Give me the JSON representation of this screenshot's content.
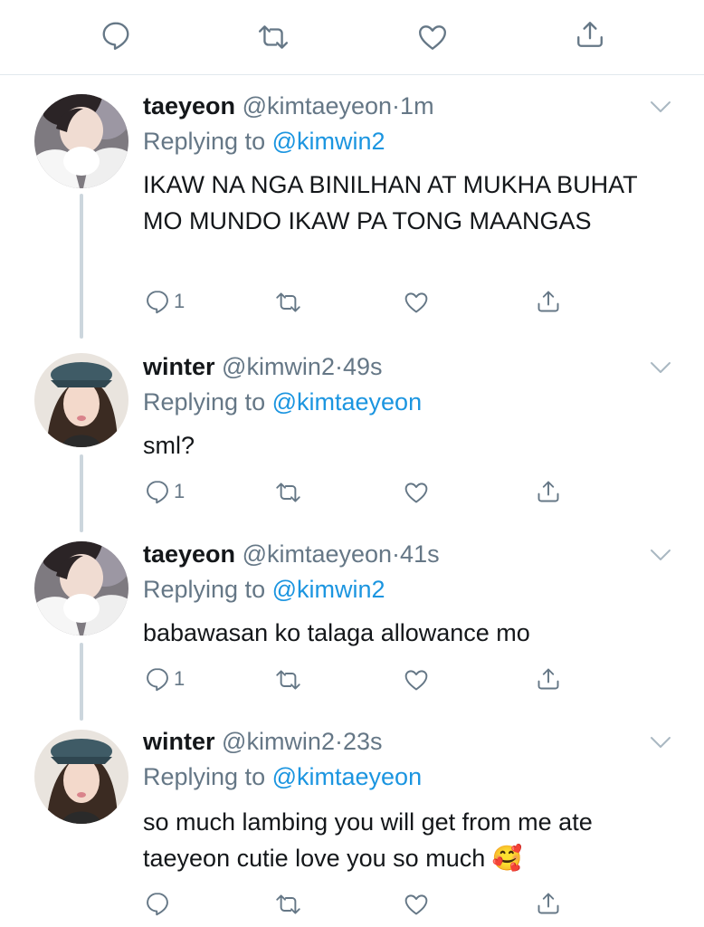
{
  "top_actions": {
    "reply_count": "",
    "retweet_count": "",
    "like_count": ""
  },
  "colors": {
    "accent": "#1b95e0",
    "secondary_text": "#657786",
    "thread_line": "#ccd6dd"
  },
  "tweets": [
    {
      "name": "taeyeon",
      "handle": "@kimtaeyeon",
      "separator": "·",
      "time": "1m",
      "replying_label": "Replying to",
      "replying_to": "@kimwin2",
      "text": "IKAW NA NGA BINILHAN AT MUKHA BUHAT MO MUNDO IKAW PA TONG MAANGAS",
      "reply_count": "1"
    },
    {
      "name": "winter",
      "handle": "@kimwin2",
      "separator": "·",
      "time": "49s",
      "replying_label": "Replying to",
      "replying_to": "@kimtaeyeon",
      "text": "sml?",
      "reply_count": "1"
    },
    {
      "name": "taeyeon",
      "handle": "@kimtaeyeon",
      "separator": "·",
      "time": "41s",
      "replying_label": "Replying to",
      "replying_to": "@kimwin2",
      "text": "babawasan ko talaga allowance mo",
      "reply_count": "1"
    },
    {
      "name": "winter",
      "handle": "@kimwin2",
      "separator": "·",
      "time": "23s",
      "replying_label": "Replying to",
      "replying_to": "@kimtaeyeon",
      "text": "so much lambing you will get from me ate taeyeon cutie love you so much 🥰",
      "reply_count": ""
    }
  ]
}
